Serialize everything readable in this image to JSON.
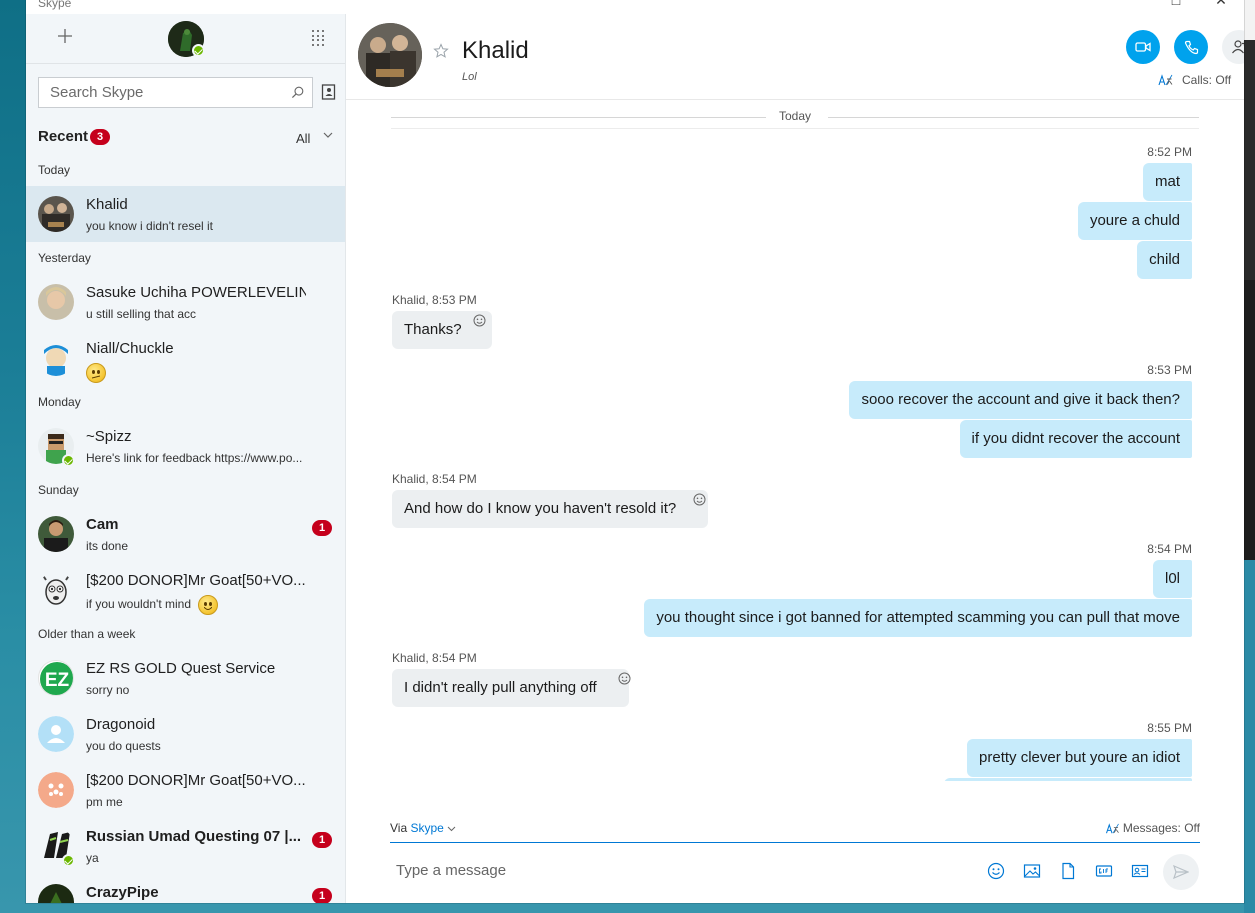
{
  "app": {
    "title": "Skype"
  },
  "sidebar": {
    "search": {
      "placeholder": "Search Skype"
    },
    "recent": {
      "label": "Recent",
      "badge": "3",
      "filter": "All"
    },
    "groups": [
      {
        "label": "Today"
      },
      {
        "label": "Yesterday"
      },
      {
        "label": "Monday"
      },
      {
        "label": "Sunday"
      },
      {
        "label": "Older than a week"
      }
    ],
    "chats": [
      {
        "name": "Khalid",
        "preview": "you know i didn't resel it"
      },
      {
        "name": "Sasuke Uchiha POWERLEVELIN...",
        "preview": "u still selling that acc"
      },
      {
        "name": "Niall/Chuckle",
        "preview": ""
      },
      {
        "name": "~Spizz",
        "preview": "Here's link for feedback https://www.po..."
      },
      {
        "name": "Cam",
        "preview": "its done",
        "unread": "1"
      },
      {
        "name": "[$200 DONOR]Mr Goat[50+VO...",
        "preview": "if you wouldn't mind"
      },
      {
        "name": "EZ RS GOLD Quest Service",
        "preview": "sorry no",
        "avatar_text": "EZ"
      },
      {
        "name": "Dragonoid",
        "preview": "you do quests"
      },
      {
        "name": "[$200 DONOR]Mr Goat[50+VO...",
        "preview": "pm me"
      },
      {
        "name": "Russian Umad Questing 07 |...",
        "preview": "ya",
        "unread": "1"
      },
      {
        "name": "CrazyPipe",
        "preview": "",
        "unread": "1"
      }
    ]
  },
  "header": {
    "name": "Khalid",
    "mood": "Lol",
    "calls": "Calls: Off"
  },
  "conversation": {
    "day": "Today",
    "messages": [
      {
        "time": "8:52 PM",
        "text": "mat"
      },
      {
        "text": "youre a chuld"
      },
      {
        "text": "child"
      },
      {
        "time": "Khalid, 8:53 PM",
        "text": "Thanks?"
      },
      {
        "time": "8:53 PM",
        "text": "sooo recover the account and give it back then?"
      },
      {
        "text": "if you didnt recover the account"
      },
      {
        "time": "Khalid, 8:54 PM",
        "text": "And how do I know you haven't resold it?"
      },
      {
        "time": "8:54 PM",
        "text": "l0l"
      },
      {
        "text": "you thought since i got banned for attempted scamming you can pull that move"
      },
      {
        "time": "Khalid, 8:54 PM",
        "text": "I didn't really pull anything off"
      },
      {
        "time": "8:55 PM",
        "text": "pretty clever but youre an idiot"
      }
    ]
  },
  "composer": {
    "via_label": "Via",
    "via_service": "Skype",
    "messages_setting": "Messages: Off",
    "placeholder": "Type a message"
  },
  "colors": {
    "accent": "#00a2ed",
    "outgoing_bubble": "#c7ebfb",
    "badge": "#c5001c",
    "online": "#6bb700"
  }
}
